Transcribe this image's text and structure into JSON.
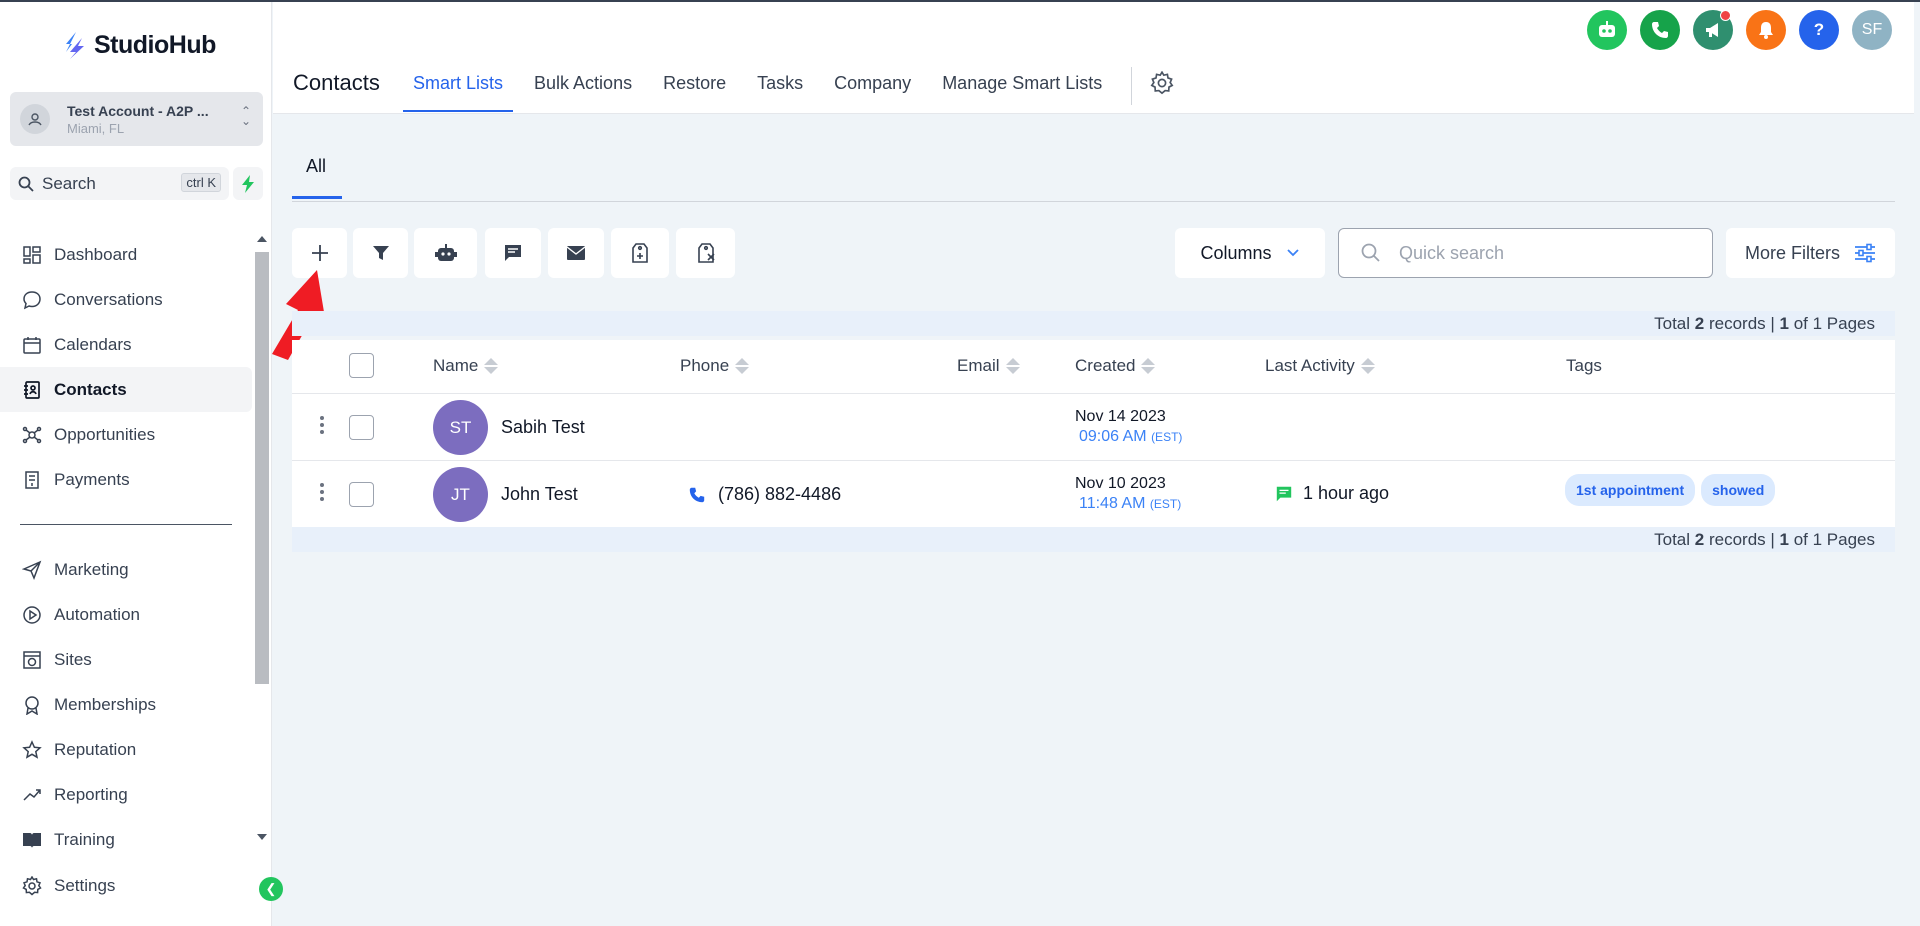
{
  "brand": {
    "name": "StudioHub",
    "accent": "#2563eb"
  },
  "account": {
    "name": "Test Account - A2P ...",
    "location": "Miami, FL"
  },
  "sidebar_search": {
    "label": "Search",
    "shortcut": "ctrl K"
  },
  "nav": {
    "items": [
      {
        "label": "Dashboard",
        "icon": "dashboard-icon"
      },
      {
        "label": "Conversations",
        "icon": "chat-bubble-icon"
      },
      {
        "label": "Calendars",
        "icon": "calendar-icon"
      },
      {
        "label": "Contacts",
        "icon": "contacts-book-icon",
        "active": true
      },
      {
        "label": "Opportunities",
        "icon": "opportunities-icon"
      },
      {
        "label": "Payments",
        "icon": "receipt-icon"
      }
    ],
    "items2": [
      {
        "label": "Marketing",
        "icon": "send-icon"
      },
      {
        "label": "Automation",
        "icon": "automation-icon"
      },
      {
        "label": "Sites",
        "icon": "globe-icon"
      },
      {
        "label": "Memberships",
        "icon": "badge-icon"
      },
      {
        "label": "Reputation",
        "icon": "star-icon"
      },
      {
        "label": "Reporting",
        "icon": "trend-icon"
      },
      {
        "label": "Training",
        "icon": "book-icon"
      }
    ],
    "settings": "Settings"
  },
  "header": {
    "title": "Contacts",
    "tabs": [
      "Smart Lists",
      "Bulk Actions",
      "Restore",
      "Tasks",
      "Company",
      "Manage Smart Lists"
    ],
    "active_tab": "Smart Lists",
    "avatar_initials": "SF"
  },
  "subtab": "All",
  "toolbar": {
    "columns_label": "Columns",
    "search_placeholder": "Quick search",
    "more_filters_label": "More Filters"
  },
  "pagination": {
    "prefix": "Total ",
    "records": "2",
    "mid": " records | ",
    "page": "1",
    "suffix": " of 1 Pages"
  },
  "table": {
    "columns": [
      "Name",
      "Phone",
      "Email",
      "Created",
      "Last Activity",
      "Tags"
    ],
    "rows": [
      {
        "initials": "ST",
        "name": "Sabih Test",
        "phone": "",
        "created_date": "Nov 14 2023",
        "created_time": "09:06 AM",
        "tz": "(EST)",
        "activity": "",
        "tags": []
      },
      {
        "initials": "JT",
        "name": "John Test",
        "phone": "(786) 882-4486",
        "created_date": "Nov 10 2023",
        "created_time": "11:48 AM",
        "tz": "(EST)",
        "activity": "1 hour ago",
        "tags": [
          "1st appointment",
          "showed"
        ]
      }
    ]
  }
}
